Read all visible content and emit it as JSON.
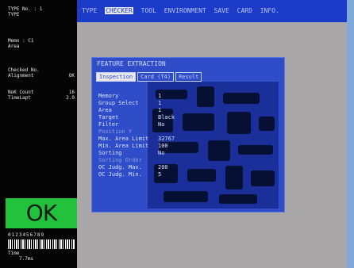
{
  "left_panel": {
    "top": [
      "TYPE No. : 1",
      "TYPE"
    ],
    "mid": [
      "Memo : C1",
      "Area"
    ],
    "stats": [
      {
        "label": "Checked No.",
        "value": ""
      },
      {
        "label": "Alignment",
        "value": "OK"
      },
      {
        "label": "NoK Count",
        "value": "16"
      },
      {
        "label": "TimeLapt",
        "value": "2.0"
      }
    ],
    "ok_label": "OK",
    "barcode_digits": "0123456789",
    "time_label": "Time",
    "time_value": "7.7ms"
  },
  "menubar": {
    "items": [
      "TYPE",
      "CHECKER",
      "TOOL",
      "ENVIRONMENT",
      "SAVE",
      "CARD",
      "INFO."
    ],
    "active_index": 1
  },
  "dialog": {
    "title": "FEATURE EXTRACTION",
    "tabs": [
      "Inspection",
      "Card (T4)",
      "Result"
    ],
    "active_tab": 0,
    "params": [
      {
        "label": "Memory",
        "value": "1"
      },
      {
        "label": "Group Select",
        "value": "1"
      },
      {
        "label": "Area",
        "value": "1"
      },
      {
        "label": "Target",
        "value": "Black"
      },
      {
        "label": "Filter",
        "value": "No"
      },
      {
        "label": "Position Y",
        "value": "",
        "dim": true
      },
      {
        "label": "Max. Area Limit",
        "value": "32767"
      },
      {
        "label": "Min. Area Limit",
        "value": "100"
      },
      {
        "label": "Sorting",
        "value": "No"
      },
      {
        "label": "Sorting Order",
        "value": "",
        "dim": true
      },
      {
        "label": "OC Judg. Max.",
        "value": "200"
      },
      {
        "label": "OC Judg. Min.",
        "value": "5"
      }
    ]
  },
  "colors": {
    "menubar_bg": "#1d3bc9",
    "dialog_bg": "#2f4cc9",
    "ok_bg": "#22c23c",
    "screen_bg": "#a9a7a8"
  }
}
